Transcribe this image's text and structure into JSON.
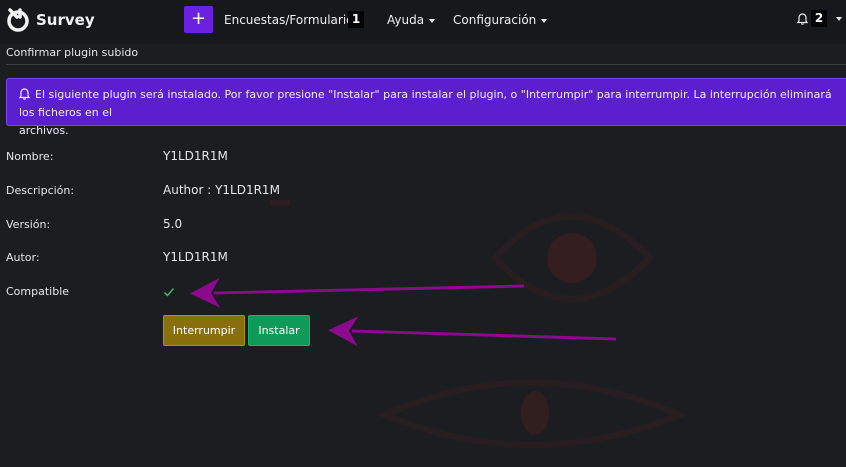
{
  "app": {
    "name": "Survey"
  },
  "nav": {
    "plus_label": "+",
    "surveys_label": "Encuestas/Formularios",
    "surveys_count": "1",
    "help_label": "Ayuda",
    "config_label": "Configuración",
    "notifications_count": "2"
  },
  "page": {
    "title": "Confirmar plugin subido"
  },
  "alert": {
    "line1": "El siguiente plugin será instalado. Por favor presione \"Instalar\" para instalar el plugin, o \"Interrumpir\" para interrumpir. La interrupción eliminará los ficheros en el",
    "line2": "archivos."
  },
  "plugin": {
    "name_label": "Nombre:",
    "name_value": "Y1LD1R1M",
    "desc_label": "Descripción:",
    "desc_value": "Author : Y1LD1R1M",
    "version_label": "Versión:",
    "version_value": "5.0",
    "author_label": "Autor:",
    "author_value": "Y1LD1R1M",
    "compatible_label": "Compatible",
    "compatible": true
  },
  "buttons": {
    "abort_label": "Interrumpir",
    "install_label": "Instalar"
  },
  "colors": {
    "accent": "#6a22e0",
    "alert_bg": "#5b1fd0",
    "abort_bg": "#8a6f0d",
    "install_bg": "#0e9a58",
    "check": "#3ac16a",
    "annotation_arrow": "#8b0a8e"
  },
  "icons": {
    "logo": "survey-logo-icon",
    "bell": "bell-icon",
    "check": "check-icon"
  }
}
